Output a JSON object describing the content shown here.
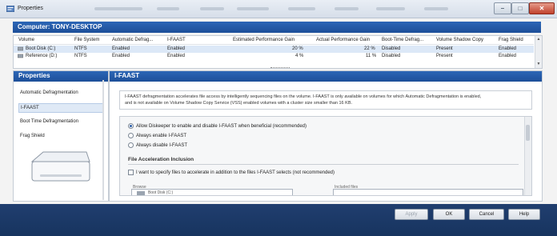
{
  "window": {
    "title": "Properties"
  },
  "computer": {
    "label": "Computer: TONY-DESKTOP"
  },
  "volumes": {
    "headers": [
      "Volume",
      "File System",
      "Automatic Defrag...",
      "I-FAAST",
      "Estimated Performance Gain",
      "Actual Performance Gain",
      "Boot-Time Defrag...",
      "Volume Shadow Copy",
      "Frag Shield"
    ],
    "rows": [
      [
        "Boot Disk (C:)",
        "NTFS",
        "Enabled",
        "Enabled",
        "20 %",
        "22 %",
        "Disabled",
        "Present",
        "Enabled"
      ],
      [
        "Reference (D:)",
        "NTFS",
        "Enabled",
        "Enabled",
        "4 %",
        "11 %",
        "Disabled",
        "Present",
        "Enabled"
      ]
    ]
  },
  "left_panel": {
    "title": "Properties",
    "items": [
      "Automatic Defragmentation",
      "I-FAAST",
      "Boot Time Defragmentation",
      "Frag Shield"
    ]
  },
  "right_panel": {
    "title": "I-FAAST",
    "desc_line1": "I-FAAST defragmentation accelerates file access by intelligently sequencing files on the volume. I-FAAST is only available on volumes for which Automatic Defragmentation is enabled,",
    "desc_line2": "and is not available on Volume Shadow Copy Service (VSS) enabled volumes with a cluster size smaller than 16 KB.",
    "options": [
      "Allow Diskeeper to enable and disable I-FAAST when beneficial (recommended)",
      "Always enable I-FAAST",
      "Always disable I-FAAST"
    ],
    "section_title": "File Acceleration Inclusion",
    "checkbox_label": "I want to specify files to accelerate in addition to the files I-FAAST selects (not recommended)",
    "browse_label": "Browse",
    "browse_value": "Boot Disk (C:)",
    "included_label": "Included files"
  },
  "buttons": {
    "apply": "Apply",
    "ok": "OK",
    "cancel": "Cancel",
    "help": "Help"
  },
  "colors": {
    "header_blue": "#1d4f99",
    "footer_navy": "#17345f",
    "selection": "#dce8f7"
  }
}
